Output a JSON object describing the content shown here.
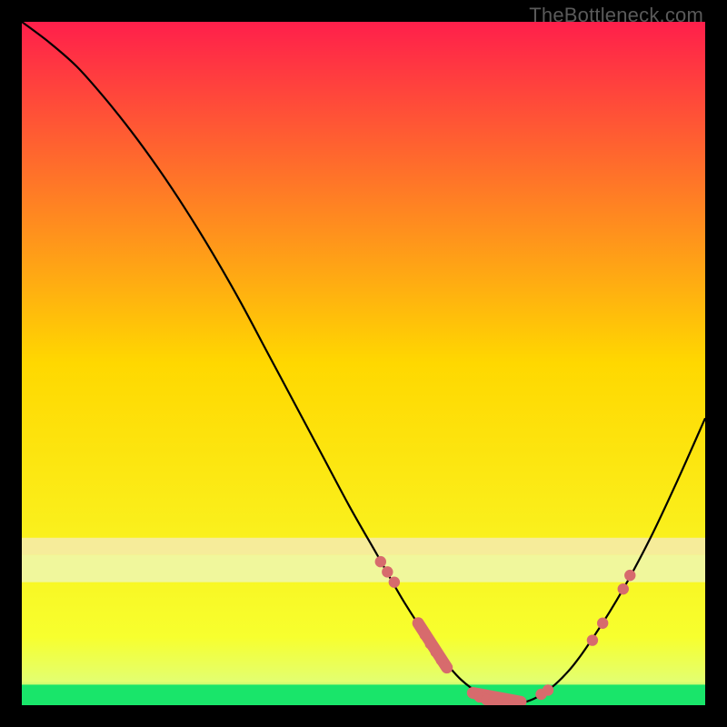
{
  "watermark": "TheBottleneck.com",
  "chart_data": {
    "type": "line",
    "title": "",
    "xlabel": "",
    "ylabel": "",
    "xlim": [
      0,
      100
    ],
    "ylim": [
      0,
      100
    ],
    "grid": false,
    "legend": false,
    "background_gradient": {
      "stops": [
        {
          "offset": 0.0,
          "color": "#ff1f4b"
        },
        {
          "offset": 0.5,
          "color": "#ffd800"
        },
        {
          "offset": 0.9,
          "color": "#f7ff2e"
        },
        {
          "offset": 0.965,
          "color": "#e3ff70"
        },
        {
          "offset": 1.0,
          "color": "#19e56a"
        }
      ]
    },
    "curve": {
      "description": "Bottleneck curve; y≈100 at x≈0 descending to ≈0 near x≈70 then rising toward ≈42 at x≈100",
      "x": [
        0,
        4,
        8,
        12,
        16,
        20,
        24,
        28,
        32,
        36,
        40,
        44,
        48,
        52,
        56,
        60,
        64,
        68,
        72,
        76,
        80,
        84,
        88,
        92,
        96,
        100
      ],
      "y": [
        100,
        97,
        93.5,
        89,
        84,
        78.5,
        72.5,
        66,
        59,
        51.5,
        44,
        36.5,
        29,
        22,
        15,
        9,
        4,
        1.2,
        0.2,
        1.5,
        5,
        10.5,
        17,
        24.5,
        33,
        42
      ]
    },
    "highlight_bands": [
      {
        "y_top": 24.5,
        "y_bottom": 22.0,
        "color": "#f6ec9a"
      },
      {
        "y_top": 22.0,
        "y_bottom": 18.0,
        "color": "#f0f79c"
      },
      {
        "y_top": 3.0,
        "y_bottom": 0.0,
        "color": "#19e56a"
      }
    ],
    "markers": {
      "color": "#d76b6d",
      "points": [
        {
          "x": 52.5,
          "y": 21.0
        },
        {
          "x": 53.5,
          "y": 19.5
        },
        {
          "x": 54.5,
          "y": 18.0
        },
        {
          "x": 58.0,
          "y": 12.0
        },
        {
          "x": 59.0,
          "y": 10.3
        },
        {
          "x": 59.8,
          "y": 9.0
        },
        {
          "x": 60.6,
          "y": 7.8
        },
        {
          "x": 61.4,
          "y": 6.6
        },
        {
          "x": 62.2,
          "y": 5.5
        },
        {
          "x": 66.0,
          "y": 1.8
        },
        {
          "x": 67.0,
          "y": 1.2
        },
        {
          "x": 68.0,
          "y": 0.8
        },
        {
          "x": 69.0,
          "y": 0.4
        },
        {
          "x": 70.0,
          "y": 0.2
        },
        {
          "x": 71.0,
          "y": 0.2
        },
        {
          "x": 72.0,
          "y": 0.25
        },
        {
          "x": 73.0,
          "y": 0.5
        },
        {
          "x": 76.0,
          "y": 1.6
        },
        {
          "x": 77.0,
          "y": 2.2
        },
        {
          "x": 83.5,
          "y": 9.5
        },
        {
          "x": 85.0,
          "y": 12.0
        },
        {
          "x": 88.0,
          "y": 17.0
        },
        {
          "x": 89.0,
          "y": 19.0
        }
      ],
      "pills": [
        {
          "x1": 58.0,
          "y1": 12.0,
          "x2": 62.2,
          "y2": 5.5
        },
        {
          "x1": 66.0,
          "y1": 1.8,
          "x2": 73.0,
          "y2": 0.5
        }
      ]
    }
  }
}
